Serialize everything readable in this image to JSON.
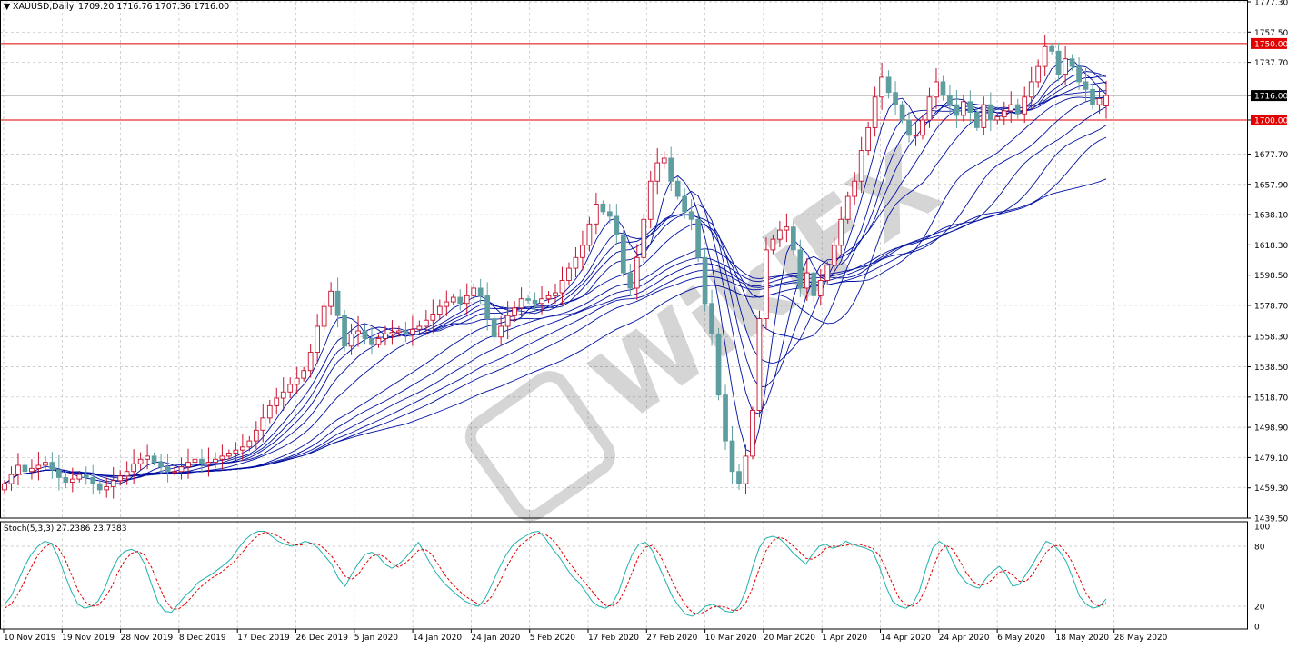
{
  "header": {
    "symbol": "XAUUSD,Daily",
    "ohlc": "1709.20 1716.76 1707.36 1716.00"
  },
  "watermark": {
    "text": "WikiFX"
  },
  "colors": {
    "bull": "#c8102e",
    "bear": "#5f9ea0",
    "ma": "#0010a0",
    "level": "#e00000",
    "stoch_main": "#20b2aa",
    "stoch_signal": "#e00000",
    "grid": "#c0c0c0"
  },
  "chart_data": [
    {
      "type": "candlestick",
      "title": "XAUUSD,Daily",
      "ylim": [
        1439.5,
        1777.3
      ],
      "y_ticks": [
        "1777.30",
        "1757.50",
        "1737.70",
        "1716.00",
        "1700.00",
        "1677.70",
        "1657.90",
        "1638.10",
        "1618.30",
        "1598.50",
        "1578.70",
        "1558.30",
        "1538.50",
        "1518.70",
        "1498.90",
        "1479.10",
        "1459.30",
        "1439.50"
      ],
      "x_ticks": [
        "10 Nov 2019",
        "19 Nov 2019",
        "28 Nov 2019",
        "8 Dec 2019",
        "17 Dec 2019",
        "26 Dec 2019",
        "5 Jan 2020",
        "14 Jan 2020",
        "24 Jan 2020",
        "5 Feb 2020",
        "17 Feb 2020",
        "27 Feb 2020",
        "10 Mar 2020",
        "20 Mar 2020",
        "1 Apr 2020",
        "14 Apr 2020",
        "24 Apr 2020",
        "6 May 2020",
        "18 May 2020",
        "28 May 2020"
      ],
      "levels": [
        {
          "value": 1750.0,
          "label": "1750.00"
        },
        {
          "value": 1700.0,
          "label": "1700.00"
        }
      ],
      "current_price": {
        "value": 1716.0,
        "label": "1716.00"
      },
      "close": [
        1462,
        1468,
        1474,
        1470,
        1472,
        1474,
        1476,
        1471,
        1466,
        1463,
        1465,
        1468,
        1466,
        1462,
        1458,
        1460,
        1464,
        1467,
        1470,
        1475,
        1478,
        1480,
        1476,
        1473,
        1470,
        1470,
        1473,
        1476,
        1478,
        1475,
        1476,
        1478,
        1480,
        1482,
        1484,
        1486,
        1490,
        1497,
        1505,
        1513,
        1518,
        1522,
        1527,
        1531,
        1536,
        1548,
        1565,
        1578,
        1588,
        1572,
        1552,
        1560,
        1562,
        1557,
        1553,
        1557,
        1560,
        1561,
        1562,
        1560,
        1563,
        1565,
        1569,
        1573,
        1578,
        1581,
        1584,
        1580,
        1585,
        1590,
        1585,
        1570,
        1558,
        1565,
        1572,
        1577,
        1583,
        1582,
        1580,
        1583,
        1585,
        1587,
        1595,
        1603,
        1610,
        1618,
        1632,
        1645,
        1640,
        1637,
        1625,
        1600,
        1590,
        1610,
        1635,
        1660,
        1672,
        1675,
        1660,
        1650,
        1640,
        1635,
        1610,
        1580,
        1560,
        1520,
        1490,
        1470,
        1462,
        1480,
        1510,
        1570,
        1615,
        1622,
        1628,
        1630,
        1615,
        1590,
        1600,
        1585,
        1595,
        1605,
        1618,
        1635,
        1650,
        1660,
        1680,
        1695,
        1715,
        1728,
        1718,
        1710,
        1700,
        1690,
        1690,
        1700,
        1715,
        1725,
        1716,
        1710,
        1703,
        1712,
        1705,
        1695,
        1710,
        1700,
        1702,
        1706,
        1710,
        1704,
        1715,
        1725,
        1735,
        1748,
        1745,
        1730,
        1740,
        1735,
        1725,
        1720,
        1710,
        1714,
        1716
      ],
      "moving_averages_periods": [
        5,
        8,
        10,
        12,
        15,
        20,
        30,
        35,
        40,
        45,
        50,
        60
      ],
      "y_tick_positions_note": "price axis with 1716.00 marker and red 1750.00/1700.00 levels"
    },
    {
      "type": "line",
      "title": "Stoch(5,3,3) 27.2386 23.7383",
      "ylim": [
        0,
        100
      ],
      "y_ticks": [
        "100",
        "80",
        "20",
        "0"
      ],
      "series": [
        {
          "name": "main",
          "values": [
            22,
            30,
            45,
            60,
            72,
            80,
            85,
            83,
            70,
            52,
            35,
            22,
            18,
            20,
            25,
            38,
            55,
            68,
            75,
            77,
            74,
            62,
            42,
            24,
            15,
            14,
            22,
            30,
            36,
            44,
            48,
            52,
            57,
            62,
            68,
            78,
            86,
            92,
            95,
            95,
            90,
            85,
            82,
            80,
            82,
            85,
            83,
            78,
            70,
            62,
            48,
            40,
            52,
            63,
            72,
            74,
            70,
            62,
            58,
            62,
            68,
            76,
            84,
            72,
            60,
            50,
            42,
            36,
            30,
            25,
            22,
            20,
            28,
            42,
            57,
            70,
            80,
            86,
            90,
            94,
            95,
            88,
            78,
            70,
            60,
            50,
            44,
            35,
            25,
            20,
            18,
            22,
            35,
            55,
            72,
            82,
            84,
            76,
            60,
            45,
            30,
            20,
            12,
            10,
            14,
            20,
            22,
            19,
            15,
            14,
            20,
            35,
            58,
            78,
            88,
            90,
            88,
            82,
            74,
            68,
            62,
            72,
            80,
            82,
            78,
            80,
            85,
            82,
            80,
            78,
            75,
            60,
            40,
            25,
            20,
            18,
            22,
            35,
            58,
            78,
            85,
            80,
            65,
            52,
            44,
            40,
            38,
            48,
            55,
            60,
            52,
            40,
            42,
            52,
            62,
            74,
            85,
            82,
            75,
            65,
            48,
            30,
            22,
            18,
            20,
            27.24
          ]
        },
        {
          "name": "signal",
          "values": [
            18,
            22,
            32,
            45,
            59,
            71,
            79,
            83,
            79,
            68,
            52,
            36,
            25,
            20,
            21,
            28,
            39,
            54,
            66,
            73,
            75,
            71,
            59,
            43,
            27,
            18,
            17,
            22,
            29,
            37,
            43,
            48,
            52,
            57,
            62,
            69,
            77,
            85,
            91,
            94,
            93,
            90,
            86,
            82,
            81,
            82,
            83,
            82,
            77,
            70,
            60,
            50,
            47,
            52,
            62,
            70,
            72,
            69,
            63,
            59,
            63,
            69,
            76,
            77,
            72,
            61,
            51,
            43,
            36,
            30,
            26,
            22,
            23,
            30,
            42,
            56,
            69,
            79,
            85,
            90,
            93,
            92,
            87,
            79,
            69,
            60,
            51,
            43,
            35,
            27,
            21,
            20,
            25,
            37,
            54,
            70,
            79,
            81,
            73,
            60,
            45,
            32,
            21,
            14,
            12,
            15,
            19,
            20,
            19,
            16,
            16,
            23,
            38,
            57,
            75,
            85,
            89,
            87,
            81,
            75,
            68,
            67,
            71,
            78,
            80,
            80,
            81,
            82,
            82,
            80,
            78,
            71,
            58,
            42,
            28,
            21,
            20,
            25,
            38,
            57,
            74,
            81,
            77,
            66,
            54,
            45,
            41,
            42,
            47,
            54,
            56,
            51,
            45,
            45,
            52,
            63,
            74,
            80,
            81,
            74,
            63,
            48,
            33,
            23,
            20,
            23.74
          ]
        }
      ]
    }
  ]
}
